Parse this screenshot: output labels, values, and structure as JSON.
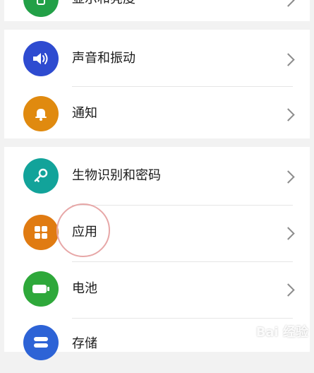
{
  "settings": {
    "items": [
      {
        "label": "显示和亮度",
        "icon": "display-icon",
        "color": "#22a047"
      },
      {
        "label": "声音和振动",
        "icon": "speaker-icon",
        "color": "#2e4bd0"
      },
      {
        "label": "通知",
        "icon": "bell-icon",
        "color": "#e08a0f"
      },
      {
        "label": "生物识别和密码",
        "icon": "key-icon",
        "color": "#12a39a"
      },
      {
        "label": "应用",
        "icon": "apps-grid-icon",
        "color": "#e07b12"
      },
      {
        "label": "电池",
        "icon": "battery-icon",
        "color": "#2ea83a"
      },
      {
        "label": "存储",
        "icon": "storage-icon",
        "color": "#2d63d6"
      }
    ]
  },
  "watermark": "Bai 经验"
}
